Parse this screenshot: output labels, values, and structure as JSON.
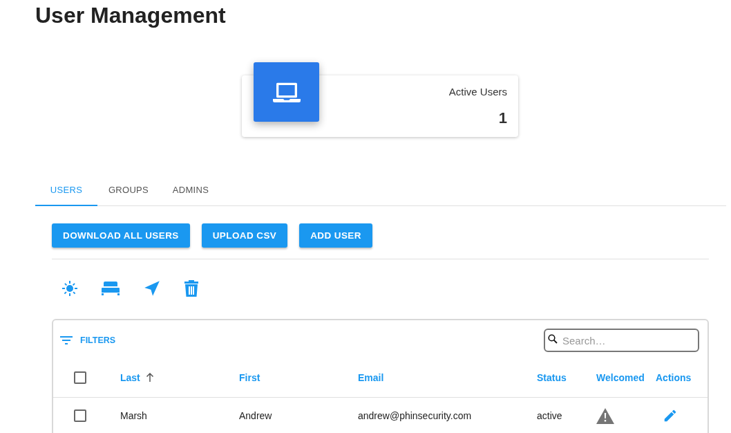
{
  "page": {
    "title": "User Management"
  },
  "stat_card": {
    "label": "Active Users",
    "value": "1"
  },
  "tabs": [
    {
      "label": "USERS",
      "selected": true
    },
    {
      "label": "GROUPS",
      "selected": false
    },
    {
      "label": "ADMINS",
      "selected": false
    }
  ],
  "buttons": [
    "DOWNLOAD ALL USERS",
    "UPLOAD CSV",
    "ADD USER"
  ],
  "toolbar_icons": [
    {
      "kind": "sun"
    },
    {
      "kind": "bed"
    },
    {
      "kind": "send"
    },
    {
      "kind": "trash"
    }
  ],
  "table": {
    "filters_label": "FILTERS",
    "search": {
      "placeholder": "Search…"
    },
    "select_all": {
      "checked": false
    },
    "columns": [
      {
        "label": "Last",
        "sorted": true
      },
      {
        "label": "First",
        "sorted": false
      },
      {
        "label": "Email",
        "sorted": false
      },
      {
        "label": "Status",
        "sorted": false
      },
      {
        "label": "Welcomed",
        "sorted": false
      },
      {
        "label": "Actions",
        "sorted": false
      }
    ],
    "rows": [
      {
        "checked": false,
        "last": "Marsh",
        "first": "Andrew",
        "email": "andrew@phinsecurity.com",
        "status": "active",
        "welcomed": false
      }
    ]
  }
}
